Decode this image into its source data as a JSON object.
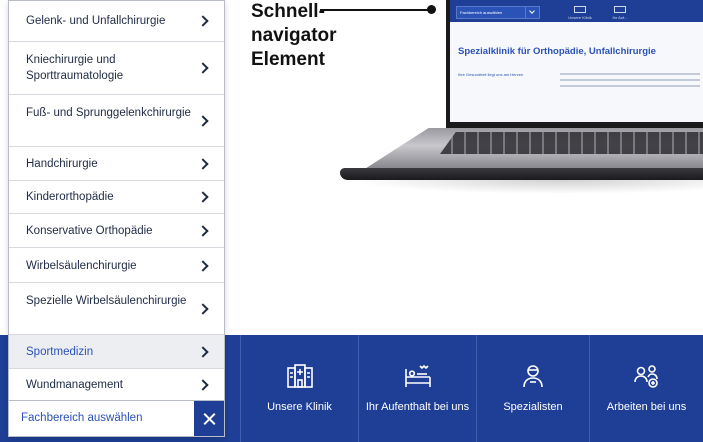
{
  "annotation": {
    "line1": "Schnell-",
    "line2": "navigator",
    "line3": "Element"
  },
  "laptop_screen": {
    "select_value": "Fachbereich auswählen",
    "nav_items": [
      "Unsere Klinik",
      "Ihr Auf..."
    ],
    "headline": "Spezialklinik für Orthopädie, Unfallchirurgie",
    "subline": "Ihre Gesundheit liegt uns am Herzen"
  },
  "dropdown": {
    "items": [
      {
        "label": "Gelenk- und Unfallchirurgie",
        "active": false
      },
      {
        "label": "Kniechirurgie und Sporttraumatologie",
        "active": false
      },
      {
        "label": "Fuß- und Sprunggelenkchirurgie",
        "active": false
      },
      {
        "label": "Handchirurgie",
        "active": false
      },
      {
        "label": "Kinderorthopädie",
        "active": false
      },
      {
        "label": "Konservative Orthopädie",
        "active": false
      },
      {
        "label": "Wirbelsäulenchirurgie",
        "active": false
      },
      {
        "label": "Spezielle Wirbelsäulenchirurgie",
        "active": false
      },
      {
        "label": "Sportmedizin",
        "active": true
      },
      {
        "label": "Wundmanagement",
        "active": false
      }
    ],
    "select_label": "Fachbereich auswählen"
  },
  "bottom_nav": {
    "items": [
      {
        "label": "Unsere Klinik",
        "icon": "hospital-icon"
      },
      {
        "label": "Ihr Aufenthalt bei uns",
        "icon": "bed-icon"
      },
      {
        "label": "Spezialisten",
        "icon": "doctor-icon"
      },
      {
        "label": "Arbeiten bei uns",
        "icon": "team-icon"
      }
    ]
  },
  "colors": {
    "brand_blue": "#1e3f95",
    "accent_blue": "#2a52b7",
    "text_dark": "#1f2a44"
  }
}
